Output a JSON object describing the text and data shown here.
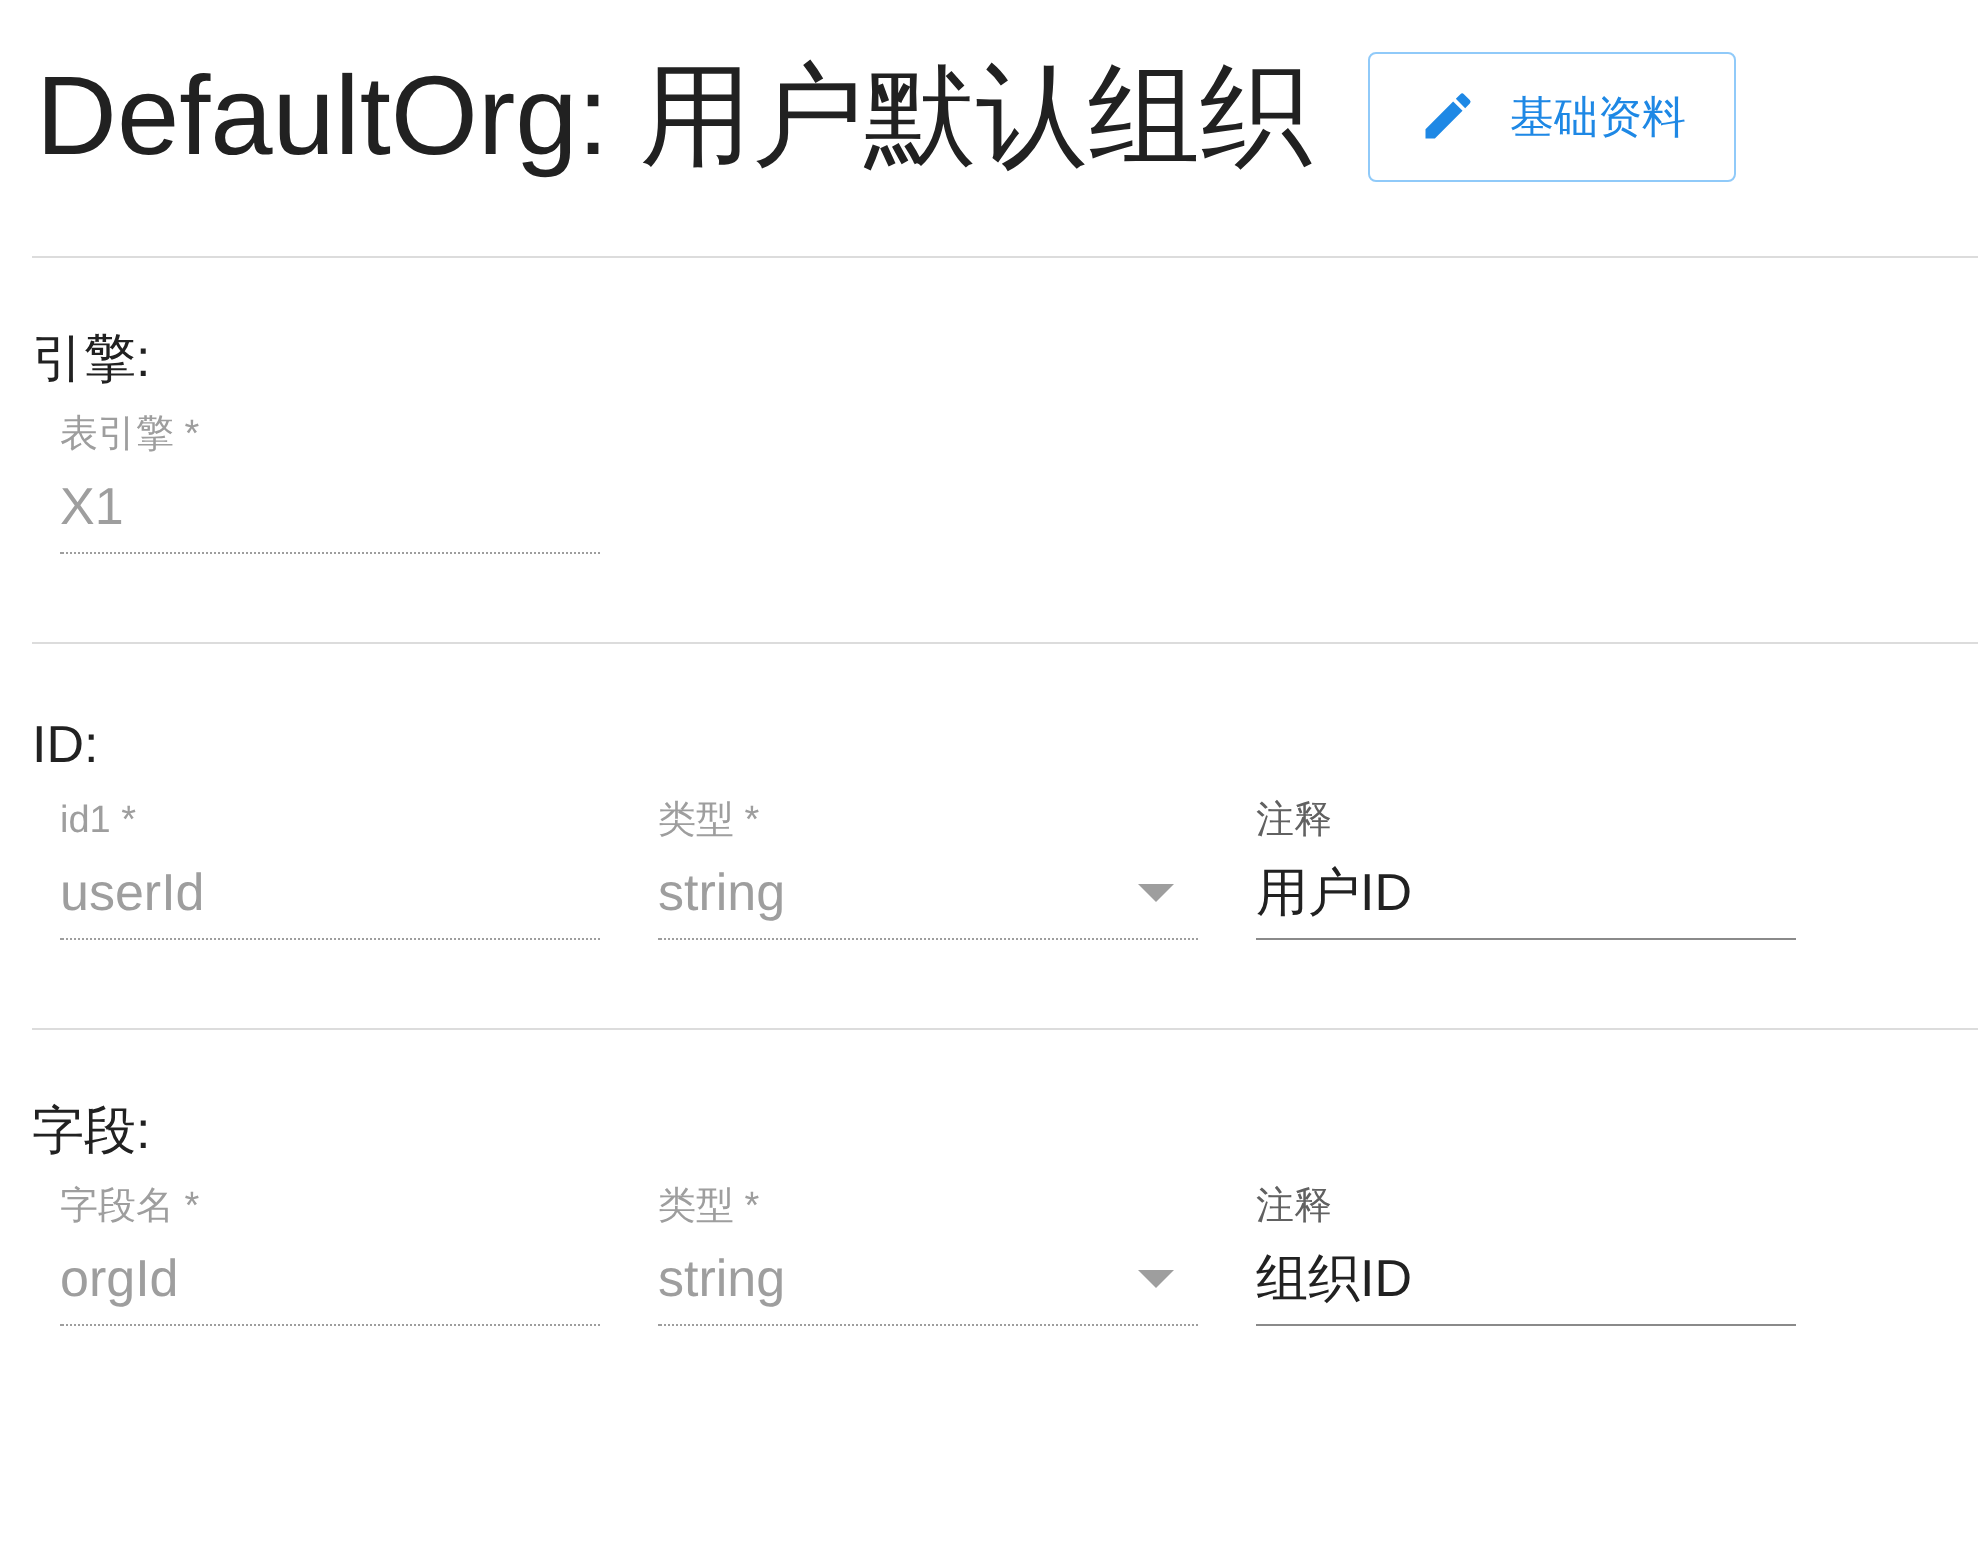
{
  "title": "DefaultOrg: 用户默认组织",
  "edit_button": {
    "label": "基础资料"
  },
  "sections": [
    {
      "heading": "引擎:",
      "fields": [
        {
          "kind": "text",
          "label": "表引擎 *",
          "value": "X1",
          "disabled": true
        }
      ]
    },
    {
      "heading": "ID:",
      "fields": [
        {
          "kind": "text",
          "label": "id1 *",
          "value": "userId",
          "disabled": true
        },
        {
          "kind": "select",
          "label": "类型 *",
          "value": "string",
          "disabled": true
        },
        {
          "kind": "text",
          "label": "注释",
          "value": "用户ID",
          "disabled": false
        }
      ]
    },
    {
      "heading": "字段:",
      "fields": [
        {
          "kind": "text",
          "label": "字段名 *",
          "value": "orgId",
          "disabled": true
        },
        {
          "kind": "select",
          "label": "类型 *",
          "value": "string",
          "disabled": true
        },
        {
          "kind": "text",
          "label": "注释",
          "value": "组织ID",
          "disabled": false
        }
      ]
    }
  ]
}
